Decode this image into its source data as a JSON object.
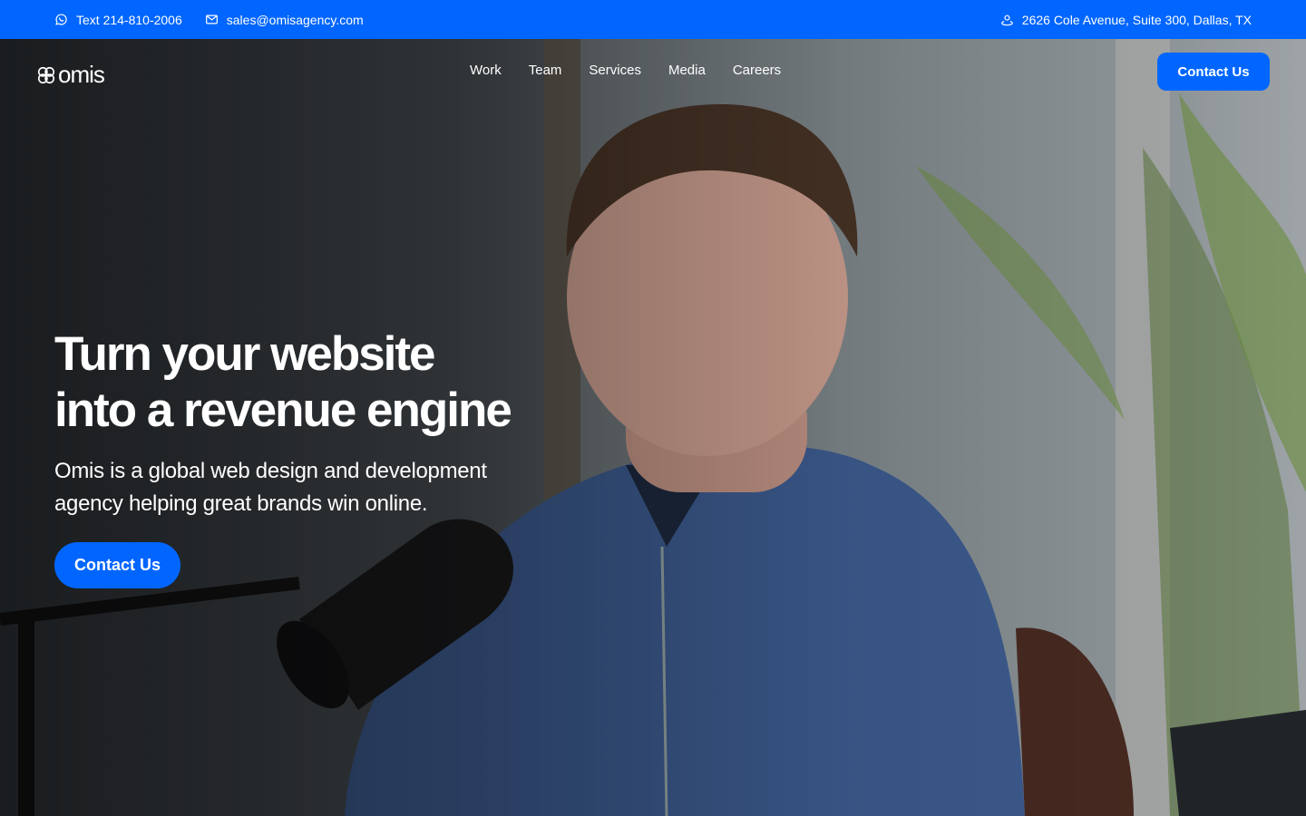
{
  "topbar": {
    "phone": "Text 214-810-2006",
    "email": "sales@omisagency.com",
    "address": "2626 Cole Avenue, Suite 300, Dallas, TX",
    "icons": {
      "phone": "chat-bubble-icon",
      "email": "envelope-icon",
      "address": "location-pin-icon"
    }
  },
  "brand": {
    "name": "omis",
    "accent": "#0066ff"
  },
  "nav": {
    "items": [
      "Work",
      "Team",
      "Services",
      "Media",
      "Careers"
    ],
    "cta": "Contact Us"
  },
  "hero": {
    "title_line1": "Turn your website",
    "title_line2": "into a revenue engine",
    "subtitle": "Omis is a global web design and development agency helping great brands win online.",
    "cta": "Contact Us"
  }
}
